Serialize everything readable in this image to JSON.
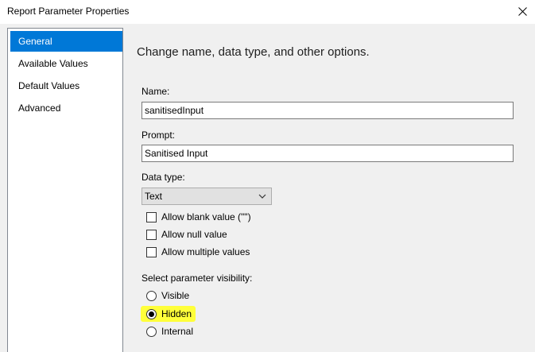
{
  "window": {
    "title": "Report Parameter Properties",
    "close_glyph": "✕"
  },
  "sidebar": {
    "items": [
      {
        "label": "General",
        "selected": true
      },
      {
        "label": "Available Values",
        "selected": false
      },
      {
        "label": "Default Values",
        "selected": false
      },
      {
        "label": "Advanced",
        "selected": false
      }
    ]
  },
  "main": {
    "heading": "Change name, data type, and other options.",
    "name": {
      "label": "Name:",
      "value": "sanitisedInput"
    },
    "prompt": {
      "label": "Prompt:",
      "value": "Sanitised Input"
    },
    "data_type": {
      "label": "Data type:",
      "value": "Text"
    },
    "checkboxes": [
      {
        "label": "Allow blank value (\"\")",
        "checked": false
      },
      {
        "label": "Allow null value",
        "checked": false
      },
      {
        "label": "Allow multiple values",
        "checked": false
      }
    ],
    "visibility": {
      "label": "Select parameter visibility:",
      "options": [
        {
          "label": "Visible",
          "checked": false
        },
        {
          "label": "Hidden",
          "checked": true
        },
        {
          "label": "Internal",
          "checked": false
        }
      ],
      "highlight_color": "#ffff3a"
    }
  },
  "colors": {
    "selection": "#0078d7",
    "dialog_bg": "#f0f0f0"
  }
}
